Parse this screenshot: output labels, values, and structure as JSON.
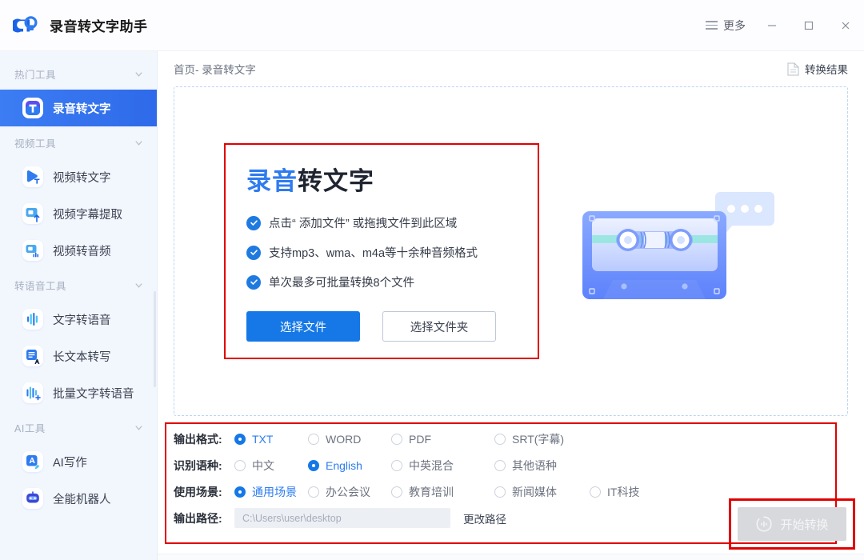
{
  "window": {
    "title": "录音转文字助手",
    "more_label": "更多",
    "minimize": "minimize",
    "maximize": "maximize",
    "close": "close"
  },
  "sidebar": {
    "groups": [
      {
        "label": "热门工具",
        "items": [
          {
            "label": "录音转文字",
            "icon": "text-t-icon",
            "active": true
          }
        ]
      },
      {
        "label": "视频工具",
        "items": [
          {
            "label": "视频转文字",
            "icon": "video-to-text-icon",
            "active": false
          },
          {
            "label": "视频字幕提取",
            "icon": "video-subtitle-icon",
            "active": false
          },
          {
            "label": "视频转音频",
            "icon": "video-to-audio-icon",
            "active": false
          }
        ]
      },
      {
        "label": "转语音工具",
        "items": [
          {
            "label": "文字转语音",
            "icon": "waveform-icon",
            "active": false
          },
          {
            "label": "长文本转写",
            "icon": "document-a-icon",
            "active": false
          },
          {
            "label": "批量文字转语音",
            "icon": "waveform-plus-icon",
            "active": false
          }
        ]
      },
      {
        "label": "AI工具",
        "items": [
          {
            "label": "AI写作",
            "icon": "a-pencil-icon",
            "active": false
          },
          {
            "label": "全能机器人",
            "icon": "robot-icon",
            "active": false
          }
        ]
      }
    ]
  },
  "breadcrumb": {
    "text": "首页- 录音转文字",
    "result_label": "转换结果",
    "result_icon": "document-icon"
  },
  "dropzone": {
    "heading_highlight": "录音",
    "heading_rest": "转文字",
    "features": [
      "点击“ 添加文件” 或拖拽文件到此区域",
      "支持mp3、wma、m4a等十余种音频格式",
      "单次最多可批量转换8个文件"
    ],
    "select_file_label": "选择文件",
    "select_folder_label": "选择文件夹",
    "illustration": "cassette-tape-illustration"
  },
  "settings": {
    "rows": [
      {
        "label": "输出格式:",
        "options": [
          {
            "label": "TXT",
            "selected": true
          },
          {
            "label": "WORD",
            "selected": false
          },
          {
            "label": "PDF",
            "selected": false
          },
          {
            "label": "SRT(字幕)",
            "selected": false
          }
        ]
      },
      {
        "label": "识别语种:",
        "options": [
          {
            "label": "中文",
            "selected": false
          },
          {
            "label": "English",
            "selected": true
          },
          {
            "label": "中英混合",
            "selected": false
          },
          {
            "label": "其他语种",
            "selected": false
          }
        ]
      },
      {
        "label": "使用场景:",
        "options": [
          {
            "label": "通用场景",
            "selected": true
          },
          {
            "label": "办公会议",
            "selected": false
          },
          {
            "label": "教育培训",
            "selected": false
          },
          {
            "label": "新闻媒体",
            "selected": false
          },
          {
            "label": "IT科技",
            "selected": false
          }
        ]
      }
    ],
    "path_label": "输出路径:",
    "path_placeholder": "C:\\Users\\user\\desktop",
    "path_value": "",
    "change_path_label": "更改路径"
  },
  "start_button": {
    "label": "开始转换",
    "icon": "convert-icon",
    "disabled": true
  },
  "colors": {
    "accent": "#1578e6",
    "accent_light": "#2b7cf0",
    "sidebar_bg": "#f2f6fd",
    "annotation_red": "#e00000",
    "disabled_gray": "#d8d9dc"
  }
}
